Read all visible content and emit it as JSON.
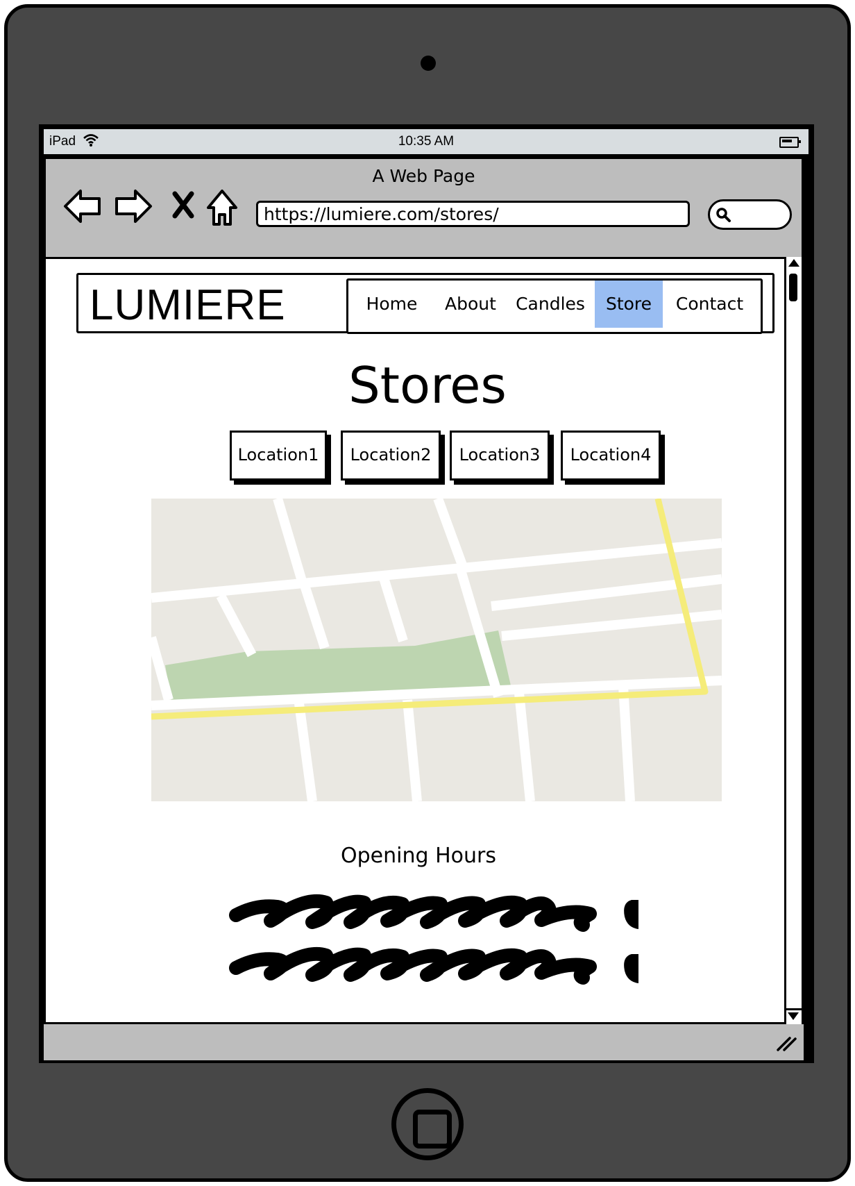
{
  "device": {
    "status_device": "iPad",
    "status_time": "10:35 AM"
  },
  "browser": {
    "title": "A Web Page",
    "url": "https://lumiere.com/stores/",
    "nav_icons": [
      "back-arrow-icon",
      "forward-arrow-icon",
      "close-icon",
      "home-icon"
    ]
  },
  "site": {
    "logo": "LUMIERE",
    "nav": [
      {
        "label": "Home",
        "active": false
      },
      {
        "label": "About",
        "active": false
      },
      {
        "label": "Candles",
        "active": false
      },
      {
        "label": "Store",
        "active": true
      },
      {
        "label": "Contact",
        "active": false
      }
    ],
    "active_color": "#99bdf2"
  },
  "main": {
    "title": "Stores",
    "locations": [
      "Location1",
      "Location2",
      "Location3",
      "Location4"
    ],
    "map_colors": {
      "blocks": "#eae8e2",
      "roads": "#ffffff",
      "park": "#bdd5b0",
      "highway": "#f5ec7a"
    },
    "hours_title": "Opening Hours"
  }
}
